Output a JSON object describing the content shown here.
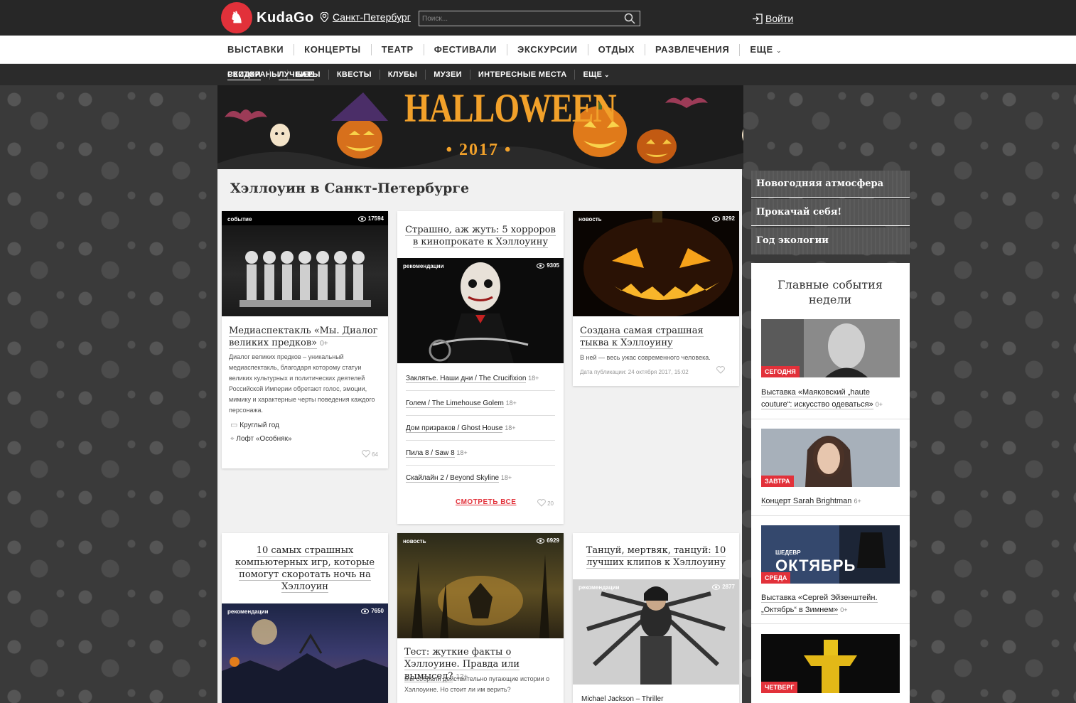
{
  "header": {
    "logo_text": "KudaGo",
    "city": "Санкт-Петербург",
    "search_placeholder": "Поиск...",
    "login": "Войти"
  },
  "nav_main": [
    "ВЫСТАВКИ",
    "КОНЦЕРТЫ",
    "ТЕАТР",
    "ФЕСТИВАЛИ",
    "ЭКСКУРСИИ",
    "ОТДЫХ",
    "РАЗВЛЕЧЕНИЯ",
    "ЕЩЕ"
  ],
  "nav_sub": [
    "РЕСТОРАНЫ",
    "БАРЫ",
    "КВЕСТЫ",
    "КЛУБЫ",
    "МУЗЕИ",
    "ИНТЕРЕСНЫЕ МЕСТА",
    "ЕЩЕ"
  ],
  "nav_sub_right": [
    "СКИДКИ",
    "ЛУЧШЕЕ"
  ],
  "banner": {
    "title": "HALLOWEEN",
    "year": "2017"
  },
  "page_title": "Хэллоуин в Санкт-Петербурге",
  "cards": {
    "c1": {
      "tag": "событие",
      "views": "17594",
      "title": "Медиаспектакль «Мы. Диалог великих предков»",
      "age": "0+",
      "desc": "Диалог великих предков – уникальный медиаспектакль, благодаря которому статуи великих культурных и политических деятелей Российской Империи обретают голос, эмоции, мимику и характерные черты поведения каждого персонажа.",
      "schedule": "Круглый год",
      "place": "Лофт «Особняк»",
      "likes": "64"
    },
    "c2": {
      "title": "Страшно, аж жуть: 5 хорроров в кинопрокате к Хэллоуину",
      "tag": "рекомендации",
      "views": "9305",
      "items": [
        {
          "t": "Заклятье. Наши дни / The Crucifixion",
          "a": "18+"
        },
        {
          "t": "Голем / The Limehouse Golem",
          "a": "18+"
        },
        {
          "t": "Дом призраков / Ghost House",
          "a": "18+"
        },
        {
          "t": "Пила 8 / Saw 8",
          "a": "18+"
        },
        {
          "t": "Скайлайн 2 / Beyond Skyline",
          "a": "18+"
        }
      ],
      "see_all": "СМОТРЕТЬ ВСЕ",
      "likes": "20"
    },
    "c3": {
      "tag": "новость",
      "views": "8292",
      "title": "Создана самая страшная тыква к Хэллоуину",
      "desc": "В ней — весь ужас современного человека.",
      "date": "Дата публикации: 24 октября 2017, 15:02"
    },
    "c4": {
      "title": "10 самых страшных компьютерных игр, которые помогут скоротать ночь на Хэллоуин",
      "tag": "рекомендации",
      "views": "7650"
    },
    "c5": {
      "tag": "новость",
      "views": "6929",
      "title": "Тест: жуткие факты о Хэллоуине. Правда или вымысел?",
      "age": "12+",
      "desc": "Мы собрали действительно пугающие истории о Хэллоуине. Но стоит ли им верить?"
    },
    "c6": {
      "title": "Танцуй, мертвяк, танцуй: 10 лучших клипов к Хэллоуину",
      "tag": "рекомендации",
      "views": "2877",
      "item": "Michael Jackson – Thriller"
    }
  },
  "side_promos": [
    "Новогодняя атмосфера",
    "Прокачай себя!",
    "Год экологии"
  ],
  "side": {
    "heading": "Главные события недели",
    "events": [
      {
        "day": "СЕГОДНЯ",
        "title": "Выставка «Маяковский „haute couture“: искусство одеваться»",
        "age": "0+"
      },
      {
        "day": "ЗАВТРА",
        "title": "Концерт Sarah Brightman",
        "age": "6+"
      },
      {
        "day": "СРЕДА",
        "title": "Выставка «Сергей Эйзенштейн. „Октябрь“ в Зимнем»",
        "age": "0+"
      },
      {
        "day": "ЧЕТВЕРГ",
        "title": "",
        "age": ""
      }
    ],
    "poster_texts": [
      "ШЕДЕВР",
      "ОКТЯБРЬ"
    ]
  }
}
